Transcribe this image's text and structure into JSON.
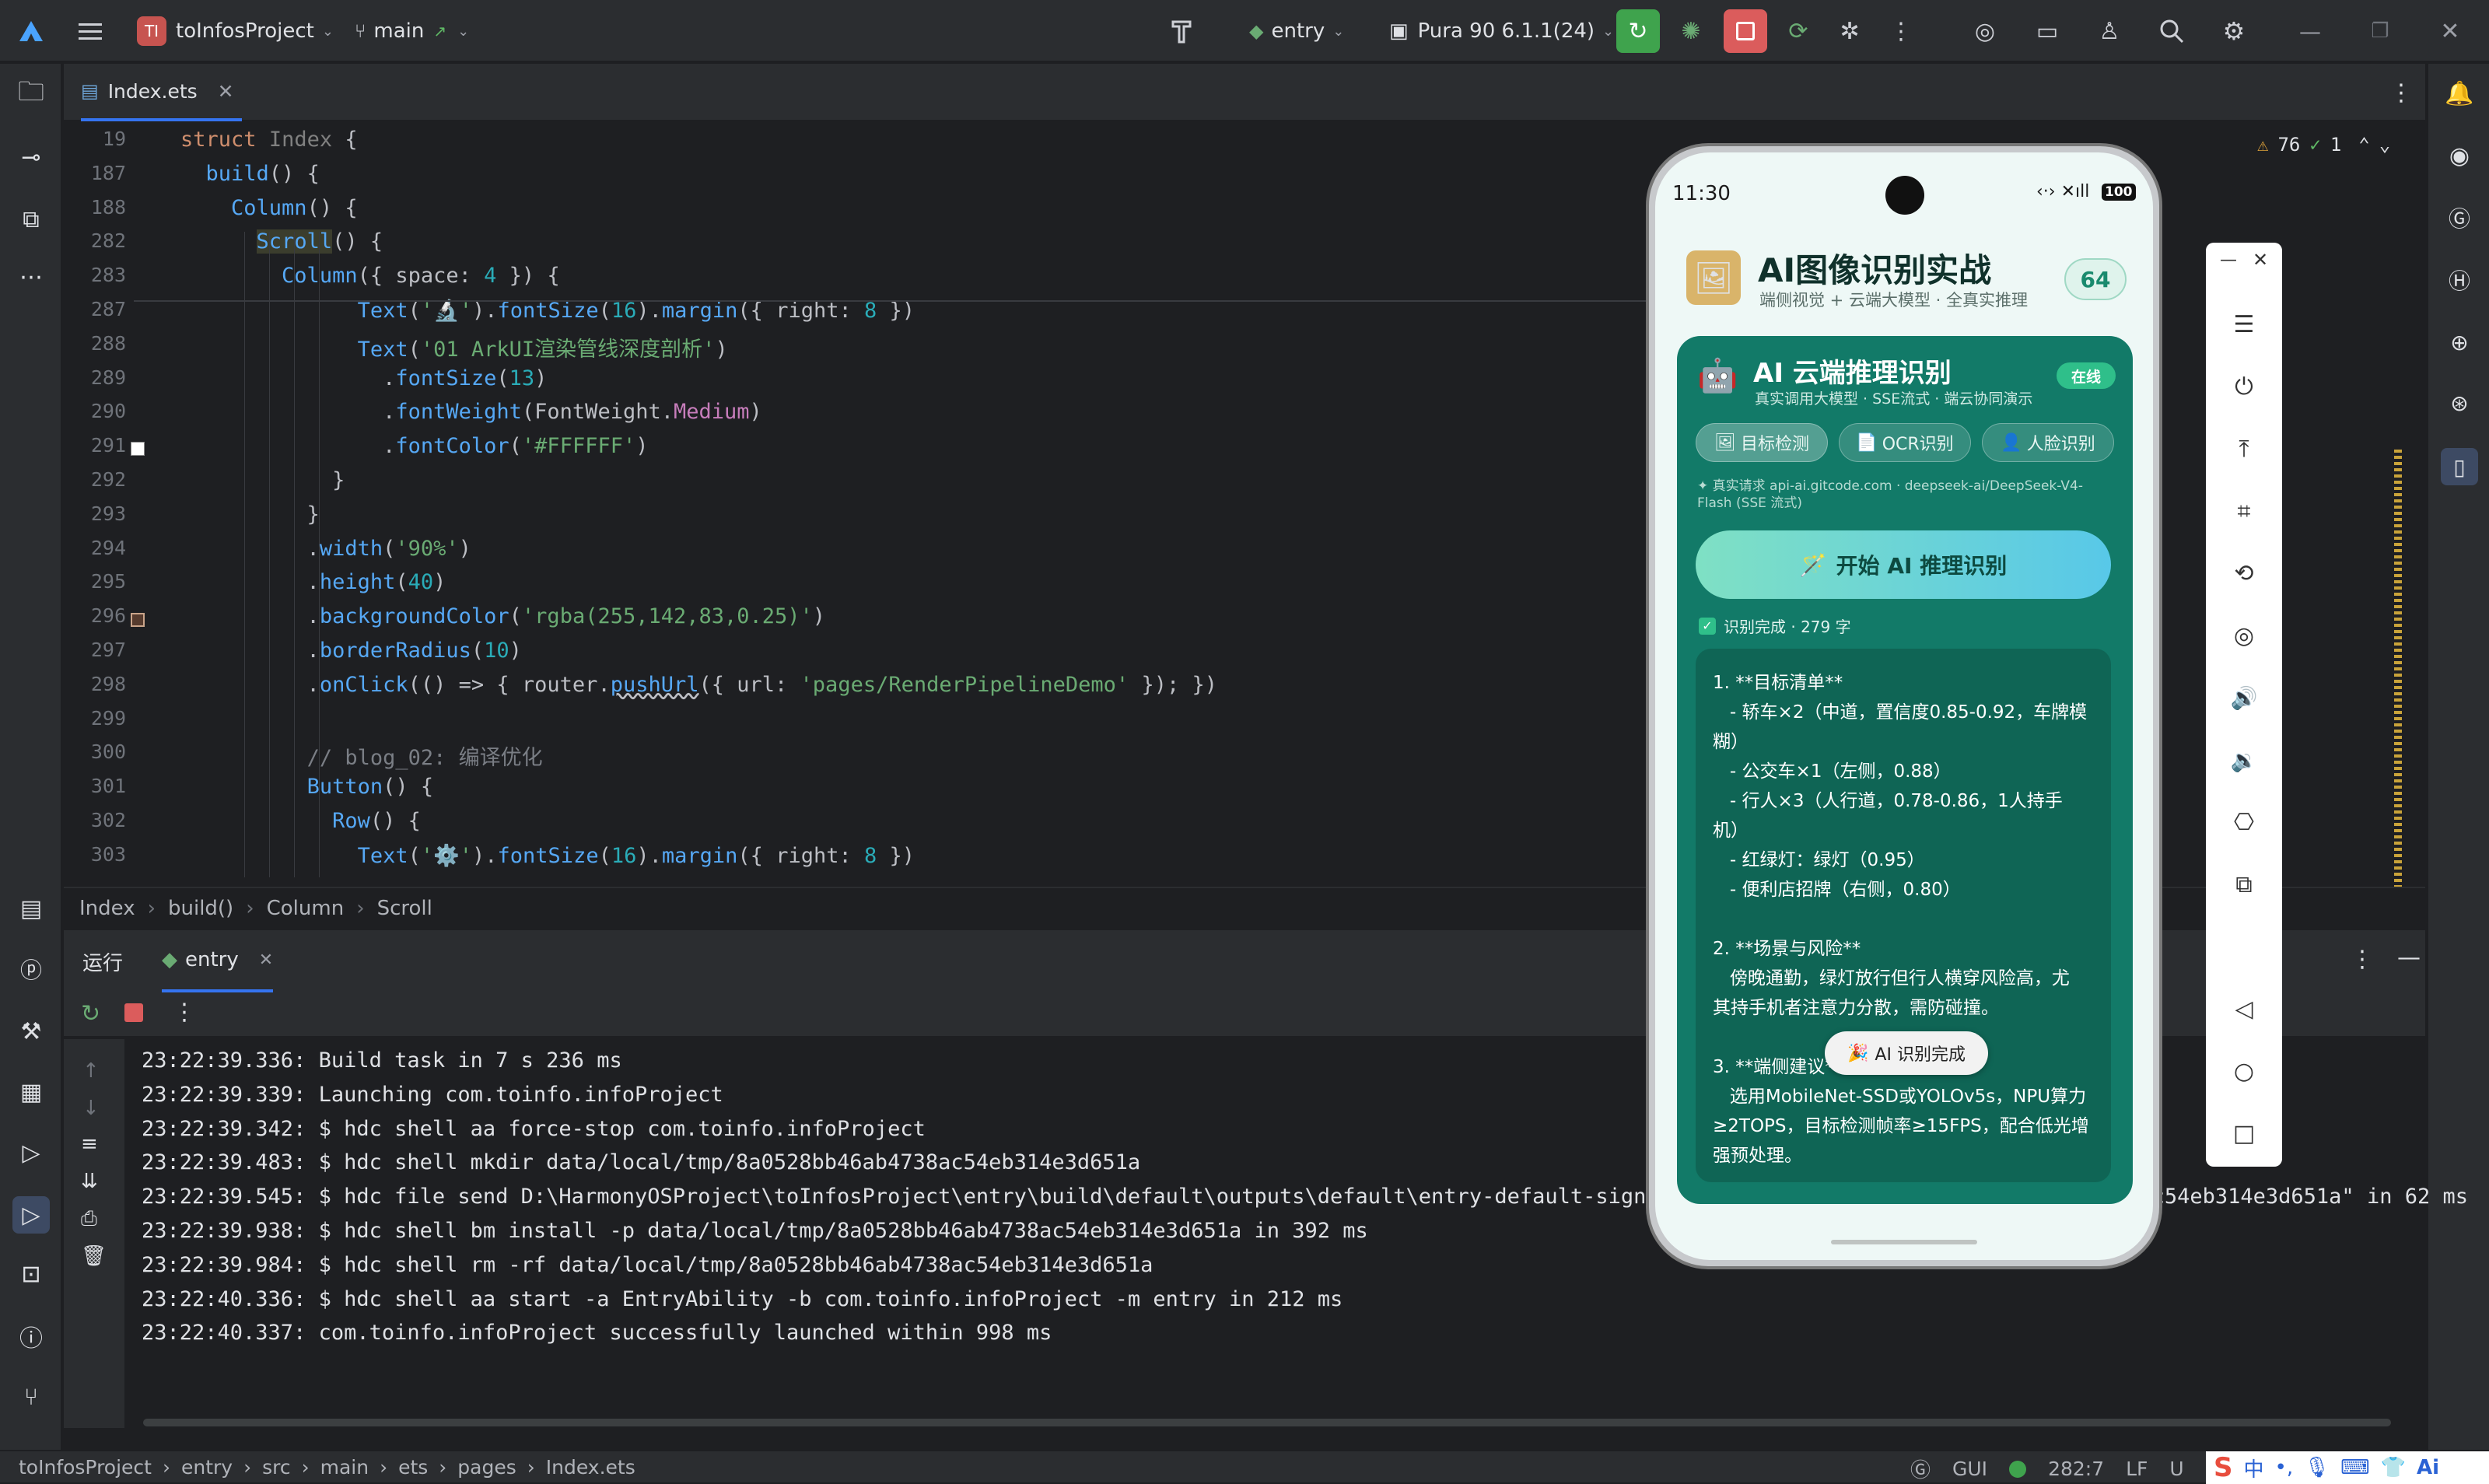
{
  "toolbar": {
    "project_initials": "TI",
    "project": "toInfosProject",
    "branch": "main",
    "run_config": "entry",
    "device": "Pura 90 6.1.1(24)"
  },
  "tab": {
    "file": "Index.ets"
  },
  "code_lines": [
    {
      "n": "19",
      "html": "<span class='kw'>struct</span> <span class='ty2'>Index</span> {"
    },
    {
      "n": "187",
      "html": "  <span class='fn'>build</span>() {"
    },
    {
      "n": "188",
      "html": "    <span class='fn'>Column</span>() {"
    },
    {
      "n": "282",
      "html": "      <span class='fn' style='background:#3b3d2d'>Scroll</span>() {"
    },
    {
      "n": "283",
      "html": "        <span class='fn'>Column</span>({ space: <span class='num'>4</span> }) {"
    },
    {
      "n": "287",
      "html": "              <span class='fn'>Text</span>(<span class='str'>'🔬'</span>).<span class='fn'>fontSize</span>(<span class='num'>16</span>).<span class='fn'>margin</span>({ right: <span class='num'>8</span> })"
    },
    {
      "n": "288",
      "html": "              <span class='fn'>Text</span>(<span class='str'>'01 ArkUI渲染管线深度剖析'</span>)"
    },
    {
      "n": "289",
      "html": "                .<span class='fn'>fontSize</span>(<span class='num'>13</span>)"
    },
    {
      "n": "290",
      "html": "                .<span class='fn'>fontWeight</span>(FontWeight.<span class='fw'>Medium</span>)"
    },
    {
      "n": "291",
      "html": "                .<span class='fn'>fontColor</span>(<span class='str'>'#FFFFFF'</span>)"
    },
    {
      "n": "292",
      "html": "            }"
    },
    {
      "n": "293",
      "html": "          }"
    },
    {
      "n": "294",
      "html": "          .<span class='fn'>width</span>(<span class='str'>'90%'</span>)"
    },
    {
      "n": "295",
      "html": "          .<span class='fn'>height</span>(<span class='num'>40</span>)"
    },
    {
      "n": "296",
      "html": "          .<span class='fn'>backgroundColor</span>(<span class='str'>'rgba(255,142,83,0.25)'</span>)"
    },
    {
      "n": "297",
      "html": "          .<span class='fn'>borderRadius</span>(<span class='num'>10</span>)"
    },
    {
      "n": "298",
      "html": "          .<span class='fn'>onClick</span>(() => { router.<span class='fn' style='text-decoration:underline wavy #bcbec4'>pushUrl</span>({ url: <span class='str'>'pages/RenderPipelineDemo'</span> }); })"
    },
    {
      "n": "299",
      "html": ""
    },
    {
      "n": "300",
      "html": "          <span class='cm'>// blog_02: 编译优化</span>"
    },
    {
      "n": "301",
      "html": "          <span class='fn'>Button</span>() {"
    },
    {
      "n": "302",
      "html": "            <span class='fn'>Row</span>() {"
    },
    {
      "n": "303",
      "html": "              <span class='fn'>Text</span>(<span class='str'>'⚙️'</span>).<span class='fn'>fontSize</span>(<span class='num'>16</span>).<span class='fn'>margin</span>({ right: <span class='num'>8</span> })"
    }
  ],
  "breadcrumb": [
    "Index",
    "build()",
    "Column",
    "Scroll"
  ],
  "run": {
    "title": "运行",
    "tab": "entry"
  },
  "console": [
    "23:22:39.336: Build task in 7 s 236 ms",
    "23:22:39.339: Launching com.toinfo.infoProject",
    "23:22:39.342: $ hdc shell aa force-stop com.toinfo.infoProject",
    "23:22:39.483: $ hdc shell mkdir data/local/tmp/8a0528bb46ab4738ac54eb314e3d651a",
    "23:22:39.545: $ hdc file send D:\\HarmonyOSProject\\toInfosProject\\entry\\build\\default\\outputs\\default\\entry-default-signed.hap \"data/local/tmp/8a0528bb46ab4738ac54eb314e3d651a\" in 62 ms",
    "23:22:39.938: $ hdc shell bm install -p data/local/tmp/8a0528bb46ab4738ac54eb314e3d651a in 392 ms",
    "23:22:39.984: $ hdc shell rm -rf data/local/tmp/8a0528bb46ab4738ac54eb314e3d651a",
    "23:22:40.336: $ hdc shell aa start -a EntryAbility -b com.toinfo.infoProject -m entry in 212 ms",
    "23:22:40.337: com.toinfo.infoProject successfully launched within 998 ms"
  ],
  "inspections": {
    "warnings": "76",
    "ok": "1"
  },
  "statusbar": {
    "path": [
      "toInfosProject",
      "entry",
      "src",
      "main",
      "ets",
      "pages",
      "Index.ets"
    ],
    "gui": "GUI",
    "position": "282:7",
    "line_ending": "LF",
    "encoding": "U"
  },
  "phone": {
    "time": "11:30",
    "battery": "100",
    "app_title": "AI图像识别实战",
    "app_subtitle": "端侧视觉 + 云端大模型 · 全真实推理",
    "score": "64",
    "card_title": "AI 云端推理识别",
    "card_subtitle": "真实调用大模型 · SSE流式 · 端云协同演示",
    "online": "在线",
    "chips": [
      "目标检测",
      "OCR识别",
      "人脸识别"
    ],
    "request_info": "真实请求 api-ai.gitcode.com · deepseek-ai/DeepSeek-V4-Flash (SSE 流式)",
    "start_button": "开始 AI 推理识别",
    "done_text": "识别完成 · 279 字",
    "result_lines": [
      "1. **目标清单**",
      "   - 轿车×2（中道，置信度0.85-0.92，车牌模",
      "糊）",
      "   - 公交车×1（左侧，0.88）",
      "   - 行人×3（人行道，0.78-0.86，1人持手",
      "机）",
      "   - 红绿灯：绿灯（0.95）",
      "   - 便利店招牌（右侧，0.80）",
      "",
      "2. **场景与风险**",
      "   傍晚通勤，绿灯放行但行人横穿风险高，尤",
      "其持手机者注意力分散，需防碰撞。",
      "",
      "3. **端侧建议**",
      "   选用MobileNet-SSD或YOLOv5s，NPU算力",
      "≥2TOPS，目标检测帧率≥15FPS，配合低光增",
      "强预处理。"
    ],
    "toast": "AI 识别完成"
  },
  "colors": {
    "accent": "#3574f0",
    "teal_card": "#127a68",
    "run_green": "#3fa34d",
    "stop_red": "#db5c5c"
  }
}
